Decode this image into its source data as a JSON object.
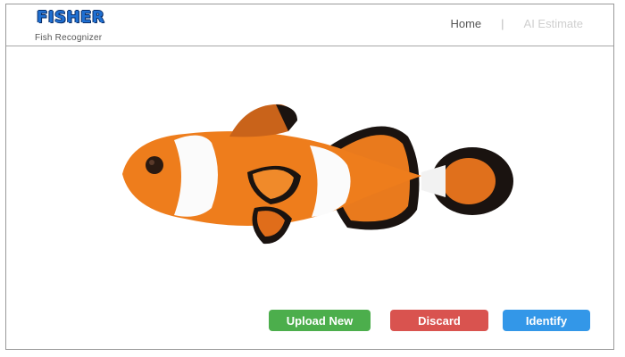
{
  "header": {
    "logo_text": "FISHER",
    "tagline": "Fish Recognizer",
    "nav": {
      "home": "Home",
      "separator": "|",
      "ai_estimate": "AI Estimate"
    }
  },
  "image": {
    "subject": "clownfish"
  },
  "actions": {
    "upload_label": "Upload New",
    "discard_label": "Discard",
    "identify_label": "Identify"
  },
  "colors": {
    "upload": "#4cae4c",
    "discard": "#d9534f",
    "identify": "#3397e8",
    "logo": "#1f6fd1"
  }
}
